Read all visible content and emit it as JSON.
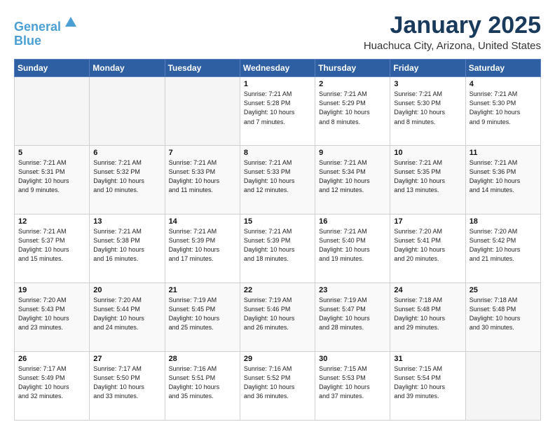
{
  "header": {
    "logo_line1": "General",
    "logo_line2": "Blue",
    "title": "January 2025",
    "subtitle": "Huachuca City, Arizona, United States"
  },
  "days_of_week": [
    "Sunday",
    "Monday",
    "Tuesday",
    "Wednesday",
    "Thursday",
    "Friday",
    "Saturday"
  ],
  "weeks": [
    [
      {
        "day": "",
        "info": ""
      },
      {
        "day": "",
        "info": ""
      },
      {
        "day": "",
        "info": ""
      },
      {
        "day": "1",
        "info": "Sunrise: 7:21 AM\nSunset: 5:28 PM\nDaylight: 10 hours\nand 7 minutes."
      },
      {
        "day": "2",
        "info": "Sunrise: 7:21 AM\nSunset: 5:29 PM\nDaylight: 10 hours\nand 8 minutes."
      },
      {
        "day": "3",
        "info": "Sunrise: 7:21 AM\nSunset: 5:30 PM\nDaylight: 10 hours\nand 8 minutes."
      },
      {
        "day": "4",
        "info": "Sunrise: 7:21 AM\nSunset: 5:30 PM\nDaylight: 10 hours\nand 9 minutes."
      }
    ],
    [
      {
        "day": "5",
        "info": "Sunrise: 7:21 AM\nSunset: 5:31 PM\nDaylight: 10 hours\nand 9 minutes."
      },
      {
        "day": "6",
        "info": "Sunrise: 7:21 AM\nSunset: 5:32 PM\nDaylight: 10 hours\nand 10 minutes."
      },
      {
        "day": "7",
        "info": "Sunrise: 7:21 AM\nSunset: 5:33 PM\nDaylight: 10 hours\nand 11 minutes."
      },
      {
        "day": "8",
        "info": "Sunrise: 7:21 AM\nSunset: 5:33 PM\nDaylight: 10 hours\nand 12 minutes."
      },
      {
        "day": "9",
        "info": "Sunrise: 7:21 AM\nSunset: 5:34 PM\nDaylight: 10 hours\nand 12 minutes."
      },
      {
        "day": "10",
        "info": "Sunrise: 7:21 AM\nSunset: 5:35 PM\nDaylight: 10 hours\nand 13 minutes."
      },
      {
        "day": "11",
        "info": "Sunrise: 7:21 AM\nSunset: 5:36 PM\nDaylight: 10 hours\nand 14 minutes."
      }
    ],
    [
      {
        "day": "12",
        "info": "Sunrise: 7:21 AM\nSunset: 5:37 PM\nDaylight: 10 hours\nand 15 minutes."
      },
      {
        "day": "13",
        "info": "Sunrise: 7:21 AM\nSunset: 5:38 PM\nDaylight: 10 hours\nand 16 minutes."
      },
      {
        "day": "14",
        "info": "Sunrise: 7:21 AM\nSunset: 5:39 PM\nDaylight: 10 hours\nand 17 minutes."
      },
      {
        "day": "15",
        "info": "Sunrise: 7:21 AM\nSunset: 5:39 PM\nDaylight: 10 hours\nand 18 minutes."
      },
      {
        "day": "16",
        "info": "Sunrise: 7:21 AM\nSunset: 5:40 PM\nDaylight: 10 hours\nand 19 minutes."
      },
      {
        "day": "17",
        "info": "Sunrise: 7:20 AM\nSunset: 5:41 PM\nDaylight: 10 hours\nand 20 minutes."
      },
      {
        "day": "18",
        "info": "Sunrise: 7:20 AM\nSunset: 5:42 PM\nDaylight: 10 hours\nand 21 minutes."
      }
    ],
    [
      {
        "day": "19",
        "info": "Sunrise: 7:20 AM\nSunset: 5:43 PM\nDaylight: 10 hours\nand 23 minutes."
      },
      {
        "day": "20",
        "info": "Sunrise: 7:20 AM\nSunset: 5:44 PM\nDaylight: 10 hours\nand 24 minutes."
      },
      {
        "day": "21",
        "info": "Sunrise: 7:19 AM\nSunset: 5:45 PM\nDaylight: 10 hours\nand 25 minutes."
      },
      {
        "day": "22",
        "info": "Sunrise: 7:19 AM\nSunset: 5:46 PM\nDaylight: 10 hours\nand 26 minutes."
      },
      {
        "day": "23",
        "info": "Sunrise: 7:19 AM\nSunset: 5:47 PM\nDaylight: 10 hours\nand 28 minutes."
      },
      {
        "day": "24",
        "info": "Sunrise: 7:18 AM\nSunset: 5:48 PM\nDaylight: 10 hours\nand 29 minutes."
      },
      {
        "day": "25",
        "info": "Sunrise: 7:18 AM\nSunset: 5:48 PM\nDaylight: 10 hours\nand 30 minutes."
      }
    ],
    [
      {
        "day": "26",
        "info": "Sunrise: 7:17 AM\nSunset: 5:49 PM\nDaylight: 10 hours\nand 32 minutes."
      },
      {
        "day": "27",
        "info": "Sunrise: 7:17 AM\nSunset: 5:50 PM\nDaylight: 10 hours\nand 33 minutes."
      },
      {
        "day": "28",
        "info": "Sunrise: 7:16 AM\nSunset: 5:51 PM\nDaylight: 10 hours\nand 35 minutes."
      },
      {
        "day": "29",
        "info": "Sunrise: 7:16 AM\nSunset: 5:52 PM\nDaylight: 10 hours\nand 36 minutes."
      },
      {
        "day": "30",
        "info": "Sunrise: 7:15 AM\nSunset: 5:53 PM\nDaylight: 10 hours\nand 37 minutes."
      },
      {
        "day": "31",
        "info": "Sunrise: 7:15 AM\nSunset: 5:54 PM\nDaylight: 10 hours\nand 39 minutes."
      },
      {
        "day": "",
        "info": ""
      }
    ]
  ]
}
